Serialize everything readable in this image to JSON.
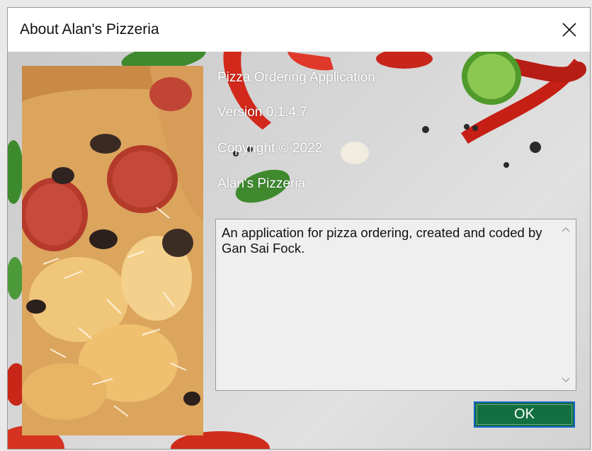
{
  "window": {
    "title": "About Alan's Pizzeria",
    "close_icon": "close-icon"
  },
  "about": {
    "product_name": "Pizza Ordering Application",
    "version": "Version 0.1.4.7",
    "copyright": "Copyright ©  2022",
    "company": "Alan's Pizzeria",
    "description": "An application for pizza ordering, created and coded by Gan Sai Fock."
  },
  "buttons": {
    "ok_label": "OK"
  },
  "colors": {
    "ok_button_bg": "#127040",
    "ok_button_border": "#1464c8",
    "label_text": "#ffffff"
  },
  "icons": {
    "scroll_up": "chevron-up-icon",
    "scroll_down": "chevron-down-icon"
  }
}
